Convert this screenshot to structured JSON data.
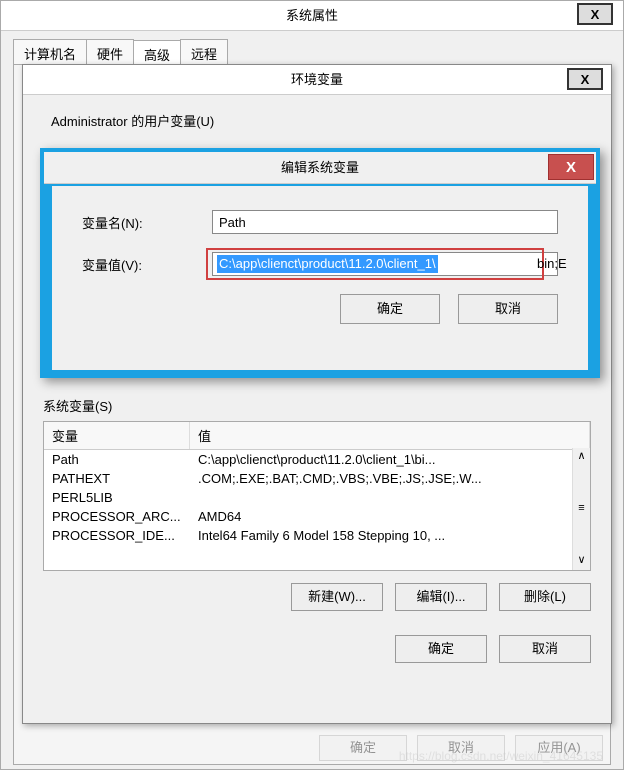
{
  "sys": {
    "title": "系统属性",
    "tabs": [
      "计算机名",
      "硬件",
      "高级",
      "远程"
    ],
    "bottom": {
      "ok": "确定",
      "cancel": "取消",
      "apply": "应用(A)"
    }
  },
  "env": {
    "title": "环境变量",
    "user_vars_label": "Administrator 的用户变量(U)",
    "sys_group_label": "系统变量(S)",
    "columns": {
      "c1": "变量",
      "c2": "值"
    },
    "rows": [
      {
        "name": "Path",
        "value": "C:\\app\\clienct\\product\\11.2.0\\client_1\\bi..."
      },
      {
        "name": "PATHEXT",
        "value": ".COM;.EXE;.BAT;.CMD;.VBS;.VBE;.JS;.JSE;.W..."
      },
      {
        "name": "PERL5LIB",
        "value": ""
      },
      {
        "name": "PROCESSOR_ARC...",
        "value": "AMD64"
      },
      {
        "name": "PROCESSOR_IDE...",
        "value": "Intel64 Family 6 Model 158 Stepping 10, ..."
      }
    ],
    "buttons": {
      "new": "新建(W)...",
      "edit": "编辑(I)...",
      "del": "删除(L)"
    },
    "bottom": {
      "ok": "确定",
      "cancel": "取消"
    }
  },
  "edit": {
    "title": "编辑系统变量",
    "name_label": "变量名(N):",
    "value_label": "变量值(V):",
    "name_value": "Path",
    "value_full": "C:\\app\\clienct\\product\\11.2.0\\client_1\\bin;E",
    "value_selected": "C:\\app\\clienct\\product\\11.2.0\\client_1\\",
    "value_rest": "bin;E",
    "ok": "确定",
    "cancel": "取消"
  },
  "watermark": "https://blog.csdn.net/weixin_41645135"
}
